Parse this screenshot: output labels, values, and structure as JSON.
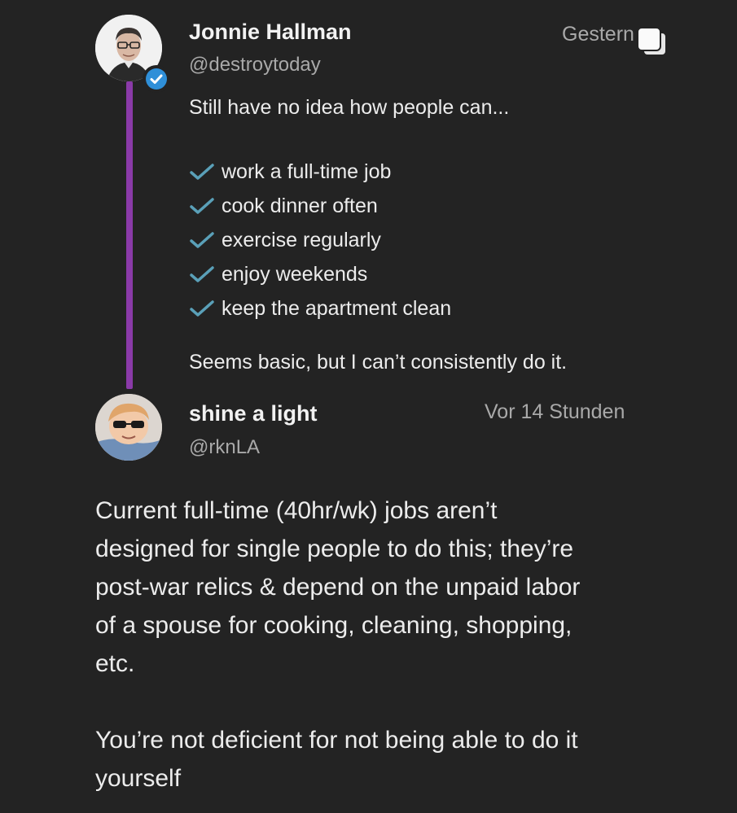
{
  "tweet": {
    "author_name": "Jonnie Hallman",
    "author_handle": "@destroytoday",
    "timestamp": "Gestern",
    "intro": "Still have no idea how people can...",
    "checklist": [
      "work a full-time job",
      "cook dinner often",
      "exercise regularly",
      "enjoy weekends",
      "keep the apartment clean"
    ],
    "closing": "Seems basic, but I can’t consistently do it."
  },
  "reply": {
    "author_name": "shine a light",
    "author_handle": "@rknLA",
    "timestamp": "Vor 14 Stunden",
    "paragraph_1": [
      "Current full-time (40hr/wk) jobs aren’t",
      "designed for single people to do this; they’re",
      "post-war relics & depend on the unpaid labor",
      "of a spouse for cooking, cleaning, shopping,",
      "etc."
    ],
    "paragraph_2": [
      "You’re not deficient for not being able to do it",
      "yourself"
    ]
  },
  "icons": {
    "verified": "verified-badge-icon",
    "check": "check-icon",
    "copy": "copy-icon"
  },
  "colors": {
    "background": "#232323",
    "thread_line": "#8a3aa8",
    "verified": "#2f8fd8",
    "check": "#5aa0b8"
  }
}
